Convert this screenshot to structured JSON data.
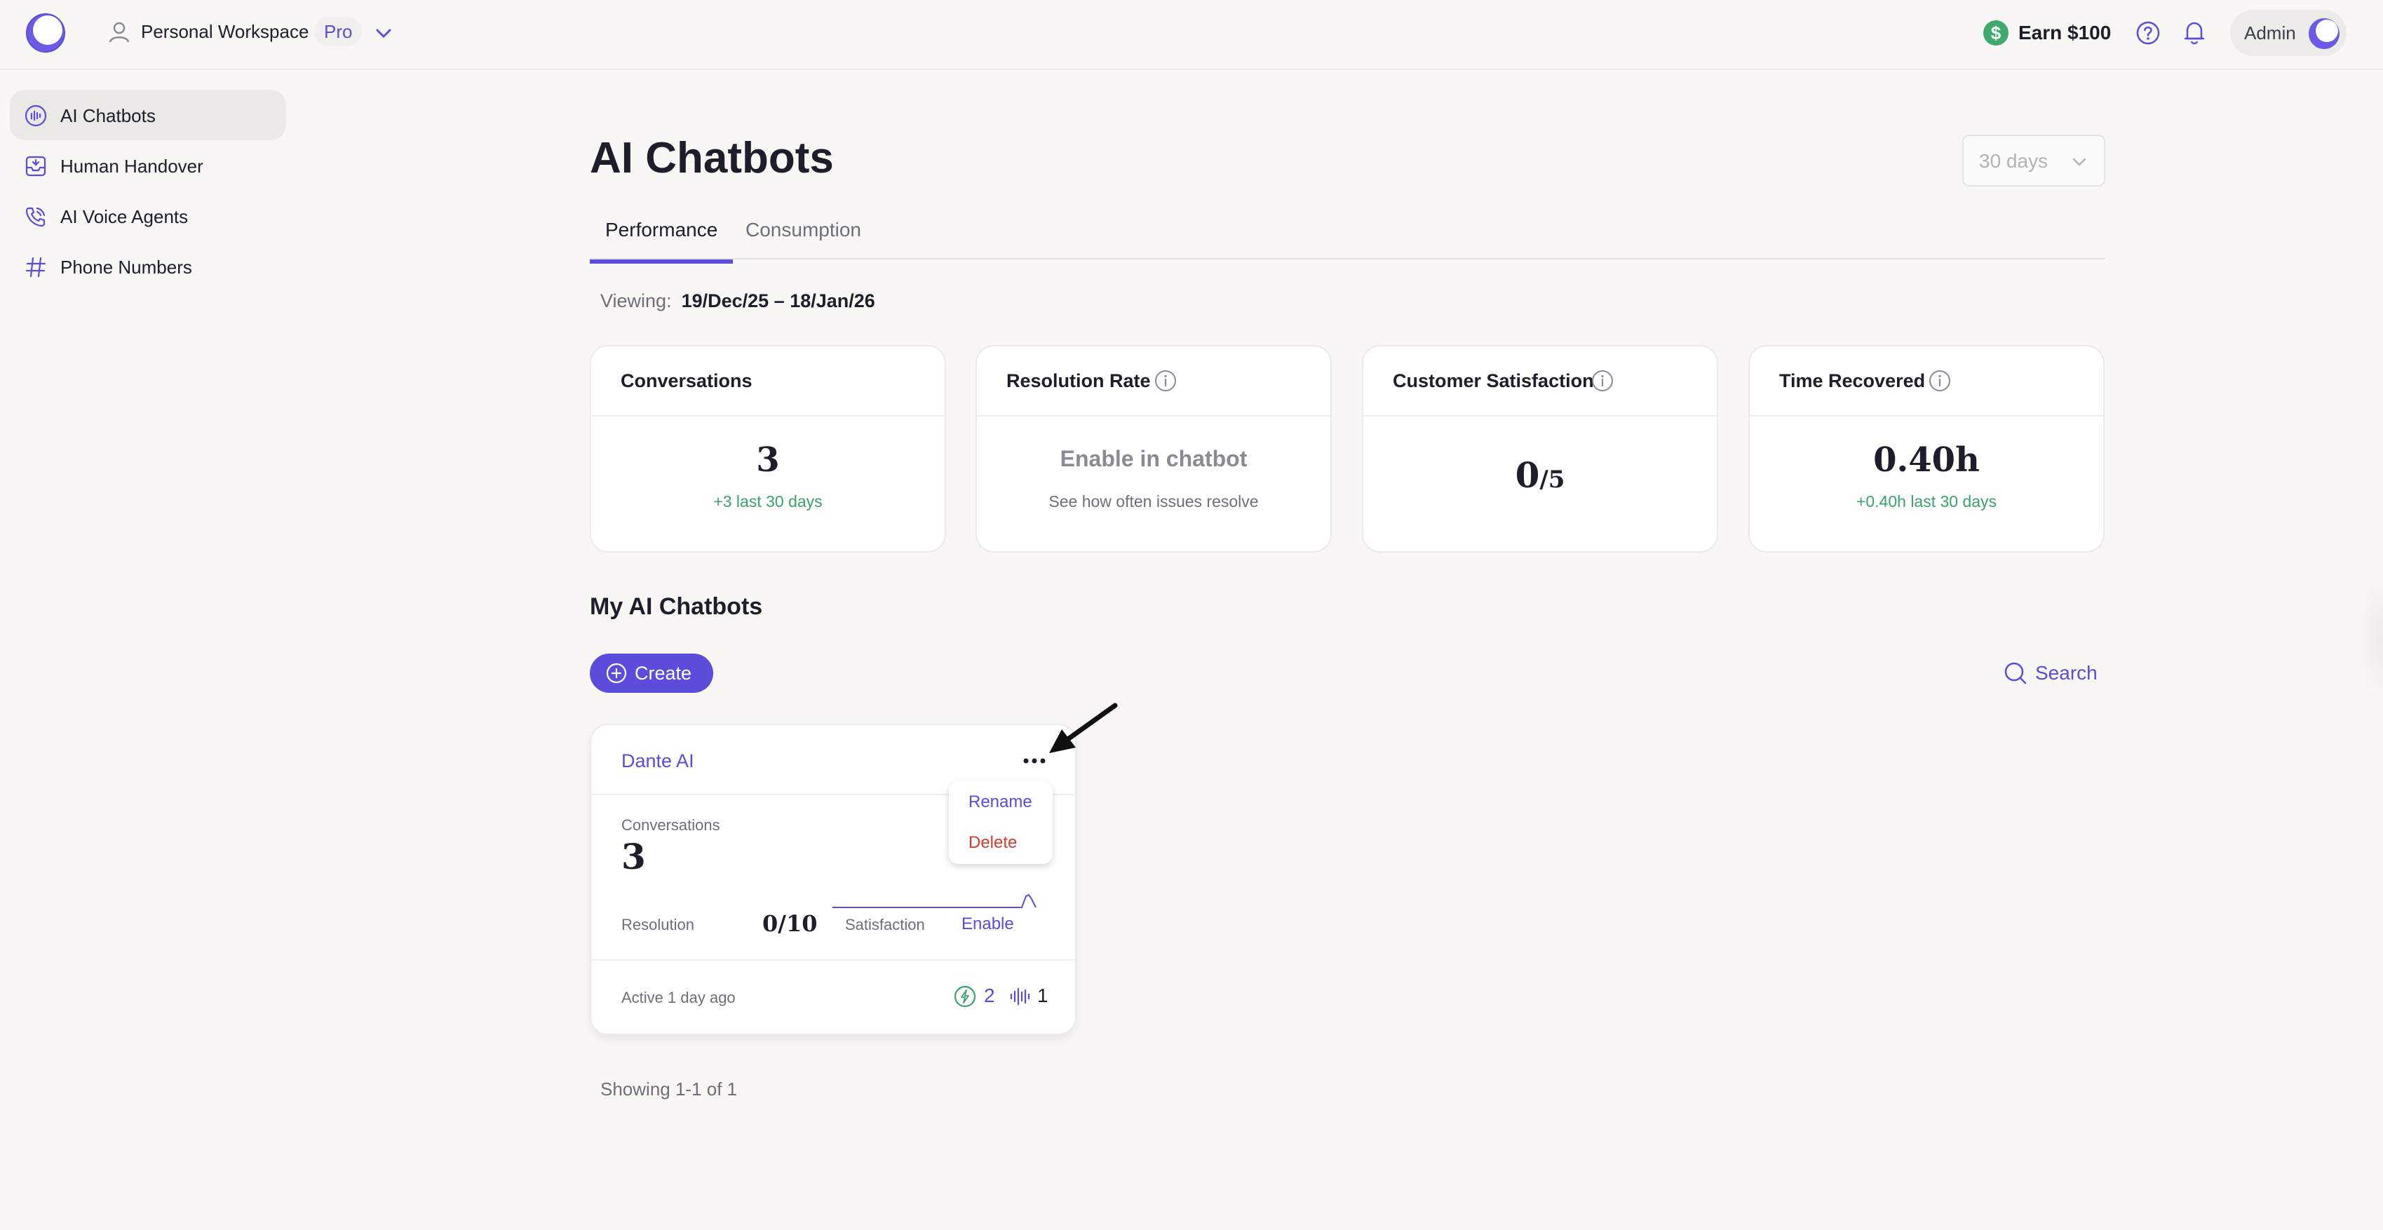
{
  "header": {
    "workspace_name": "Personal Workspace",
    "plan_badge": "Pro",
    "earn_label": "Earn $100",
    "admin_label": "Admin"
  },
  "sidebar": {
    "items": [
      {
        "label": "AI Chatbots",
        "icon": "chatbot-icon",
        "active": true
      },
      {
        "label": "Human Handover",
        "icon": "inbox-icon",
        "active": false
      },
      {
        "label": "AI Voice Agents",
        "icon": "phone-call-icon",
        "active": false
      },
      {
        "label": "Phone Numbers",
        "icon": "hash-icon",
        "active": false
      }
    ]
  },
  "main": {
    "title": "AI Chatbots",
    "range_select": "30 days",
    "tabs": [
      {
        "label": "Performance",
        "active": true
      },
      {
        "label": "Consumption",
        "active": false
      }
    ],
    "viewing_label": "Viewing:",
    "viewing_value": "19/Dec/25 – 18/Jan/26"
  },
  "stats": [
    {
      "title": "Conversations",
      "value": "3",
      "sub": "+3 last 30 days",
      "info": false
    },
    {
      "title": "Resolution Rate",
      "value": "Enable in chatbot",
      "sub": "See how often issues resolve",
      "info": true
    },
    {
      "title": "Customer Satisfaction",
      "value": "0",
      "value_suffix": "/5",
      "sub": "",
      "info": true
    },
    {
      "title": "Time Recovered",
      "value": "0.40h",
      "sub": "+0.40h last 30 days",
      "info": true
    }
  ],
  "my_bots": {
    "section_title": "My AI Chatbots",
    "create_label": "Create",
    "search_label": "Search",
    "showing": "Showing 1-1 of 1"
  },
  "bot_card": {
    "name": "Dante AI",
    "conversations_label": "Conversations",
    "conversations_value": "3",
    "resolution_label": "Resolution",
    "resolution_value": "0/10",
    "satisfaction_label": "Satisfaction",
    "satisfaction_action": "Enable",
    "active_text": "Active 1 day ago",
    "channel_chat_count": "2",
    "channel_voice_count": "1"
  },
  "context_menu": {
    "rename": "Rename",
    "delete": "Delete"
  },
  "colors": {
    "accent": "#5b4cdb",
    "success": "#3aa36a",
    "danger": "#d93a2f",
    "background": "#f8f7f5"
  }
}
